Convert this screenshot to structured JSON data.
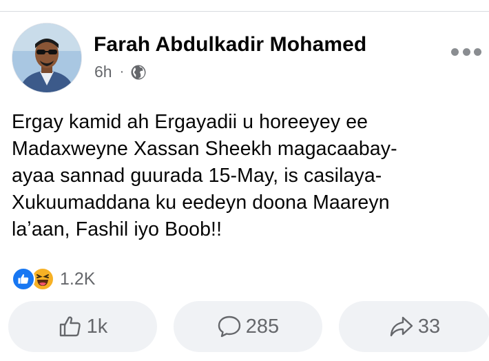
{
  "post": {
    "author": "Farah Abdulkadir Mohamed",
    "time": "6h",
    "separator": "·",
    "privacy_icon": "globe-icon",
    "text_lines": [
      "Ergay kamid ah Ergayadii u horeeyey ee",
      "Madaxweyne Xassan Sheekh magacaabay-",
      "ayaa sannad guurada 15-May, is casilaya-",
      "Xukuumaddana ku eedeyn doona Maareyn",
      "laʼaan, Fashil iyo Boob!!"
    ]
  },
  "reactions": {
    "icons": [
      "like-reaction-icon",
      "haha-reaction-icon"
    ],
    "count": "1.2K"
  },
  "actions": {
    "like": {
      "icon": "thumbs-up-icon",
      "count": "1k"
    },
    "comment": {
      "icon": "comment-bubble-icon",
      "count": "285"
    },
    "share": {
      "icon": "share-arrow-icon",
      "count": "33"
    }
  },
  "colors": {
    "text": "#050505",
    "secondary": "#65676b",
    "button_bg": "#f0f2f5",
    "like_blue": "#1877f2",
    "haha_yellow": "#f7b125"
  }
}
